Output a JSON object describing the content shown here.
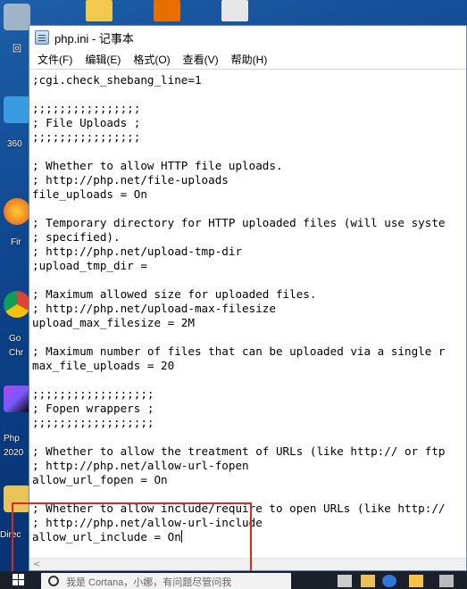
{
  "window": {
    "title": "php.ini - 记事本"
  },
  "menu": [
    {
      "label": "文件(F)"
    },
    {
      "label": "编辑(E)"
    },
    {
      "label": "格式(O)"
    },
    {
      "label": "查看(V)"
    },
    {
      "label": "帮助(H)"
    }
  ],
  "desktop_labels": [
    "回",
    "360",
    "Fir",
    "Go",
    "Chr",
    "Php",
    "2020",
    "Direc"
  ],
  "editor_lines": [
    ";cgi.check_shebang_line=1",
    "",
    ";;;;;;;;;;;;;;;;",
    "; File Uploads ;",
    ";;;;;;;;;;;;;;;;",
    "",
    "; Whether to allow HTTP file uploads.",
    "; http://php.net/file-uploads",
    "file_uploads = On",
    "",
    "; Temporary directory for HTTP uploaded files (will use syste",
    "; specified).",
    "; http://php.net/upload-tmp-dir",
    ";upload_tmp_dir =",
    "",
    "; Maximum allowed size for uploaded files.",
    "; http://php.net/upload-max-filesize",
    "upload_max_filesize = 2M",
    "",
    "; Maximum number of files that can be uploaded via a single r",
    "max_file_uploads = 20",
    "",
    ";;;;;;;;;;;;;;;;;;",
    "; Fopen wrappers ;",
    ";;;;;;;;;;;;;;;;;;",
    "",
    "; Whether to allow the treatment of URLs (like http:// or ftp",
    "; http://php.net/allow-url-fopen",
    "allow_url_fopen = On",
    "",
    "; Whether to allow include/require to open URLs (like http://",
    "; http://php.net/allow-url-include",
    "allow_url_include = On"
  ],
  "taskbar": {
    "search_text": "我是 Cortana，小娜，有问题尽管问我"
  },
  "colors": {
    "highlight": "#e0281f",
    "taskbar": "#1b1f2a"
  }
}
